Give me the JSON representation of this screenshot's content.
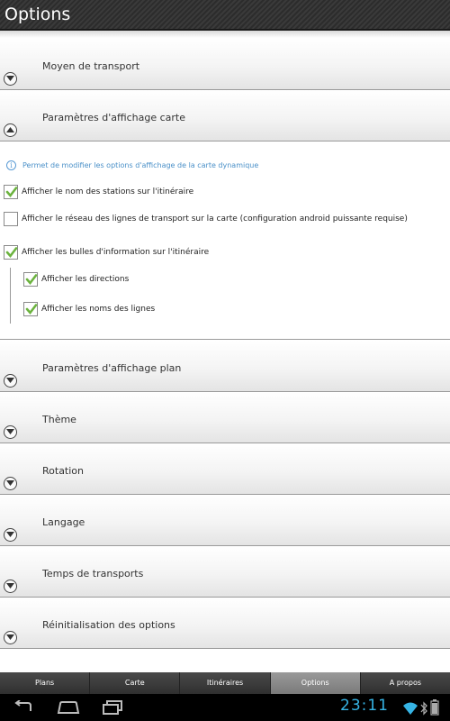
{
  "app": {
    "title": "Options"
  },
  "sections": {
    "transport": "Moyen de transport",
    "carte": "Paramètres d'affichage carte",
    "plan": "Paramètres d'affichage plan",
    "theme": "Thème",
    "rotation": "Rotation",
    "langage": "Langage",
    "temps": "Temps de transports",
    "reinit": "Réinitialisation des options"
  },
  "panel": {
    "info": "Permet de modifier les options d'affichage de la carte dynamique",
    "options": [
      {
        "label": "Afficher le nom des stations sur l'itinéraire",
        "checked": true
      },
      {
        "label": "Afficher le réseau des lignes de transport sur la carte (configuration android puissante requise)",
        "checked": false
      },
      {
        "label": "Afficher les bulles d'information sur l'itinéraire",
        "checked": true
      },
      {
        "label": "Afficher les directions",
        "checked": true
      },
      {
        "label": "Afficher les noms des lignes",
        "checked": true
      }
    ]
  },
  "tabs": [
    "Plans",
    "Carte",
    "Itinéraires",
    "Options",
    "A propos"
  ],
  "active_tab": "Options",
  "status": {
    "time": "23:11"
  },
  "icons": {
    "collapsed": "chevron-down-icon",
    "expanded": "chevron-up-icon",
    "info": "info-icon",
    "check": "check-icon",
    "nav": [
      "back-icon",
      "home-icon",
      "recent-apps-icon"
    ],
    "status": [
      "wifi-icon",
      "bluetooth-icon",
      "battery-icon"
    ]
  },
  "colors": {
    "accent": "#36b4e5",
    "check": "#6cb33f",
    "info": "#4a90c8"
  }
}
